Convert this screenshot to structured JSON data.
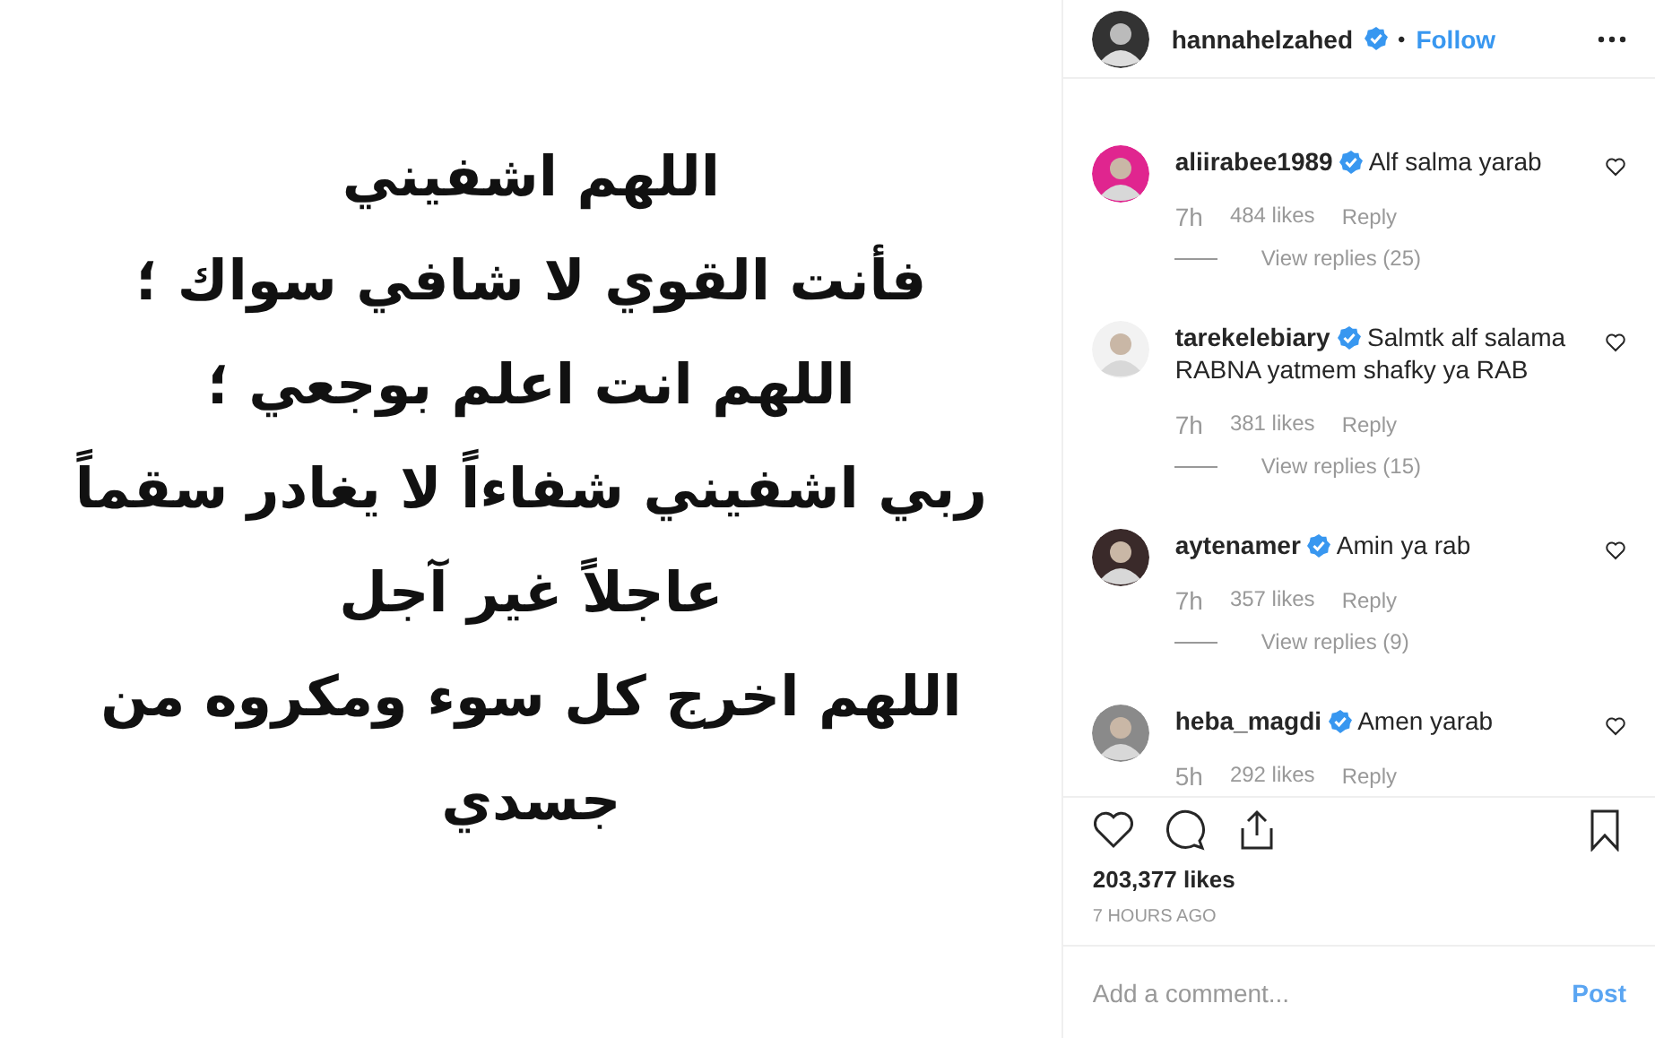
{
  "post_image": {
    "lines": [
      "اللهم اشفيني",
      "فأنت القوي لا شافي سواك ؛",
      "اللهم انت اعلم بوجعي ؛",
      "ربي اشفيني شفاءاً لا يغادر سقماً",
      "عاجلاً غير آجل",
      "اللهم اخرج كل سوء ومكروه من",
      "جسدي"
    ]
  },
  "header": {
    "username": "hannahelzahed",
    "verified": true,
    "separator": "•",
    "follow": "Follow"
  },
  "comments": [
    {
      "username": "aliirabee1989",
      "verified": true,
      "text": "Alf salma yarab",
      "time": "7h",
      "likes": "484 likes",
      "reply": "Reply",
      "view_replies": "View replies (25)"
    },
    {
      "username": "tarekelebiary",
      "verified": true,
      "text": "Salmtk alf salama RABNA yatmem shafky ya RAB",
      "time": "7h",
      "likes": "381 likes",
      "reply": "Reply",
      "view_replies": "View replies (15)"
    },
    {
      "username": "aytenamer",
      "verified": true,
      "text": "Amin ya rab",
      "time": "7h",
      "likes": "357 likes",
      "reply": "Reply",
      "view_replies": "View replies (9)"
    },
    {
      "username": "heba_magdi",
      "verified": true,
      "text": "Amen yarab",
      "time": "5h",
      "likes": "292 likes",
      "reply": "Reply"
    }
  ],
  "likes": "203,377 likes",
  "time_ago": "7 HOURS AGO",
  "comment_box": {
    "placeholder": "Add a comment...",
    "post": "Post",
    "disabled": true
  }
}
